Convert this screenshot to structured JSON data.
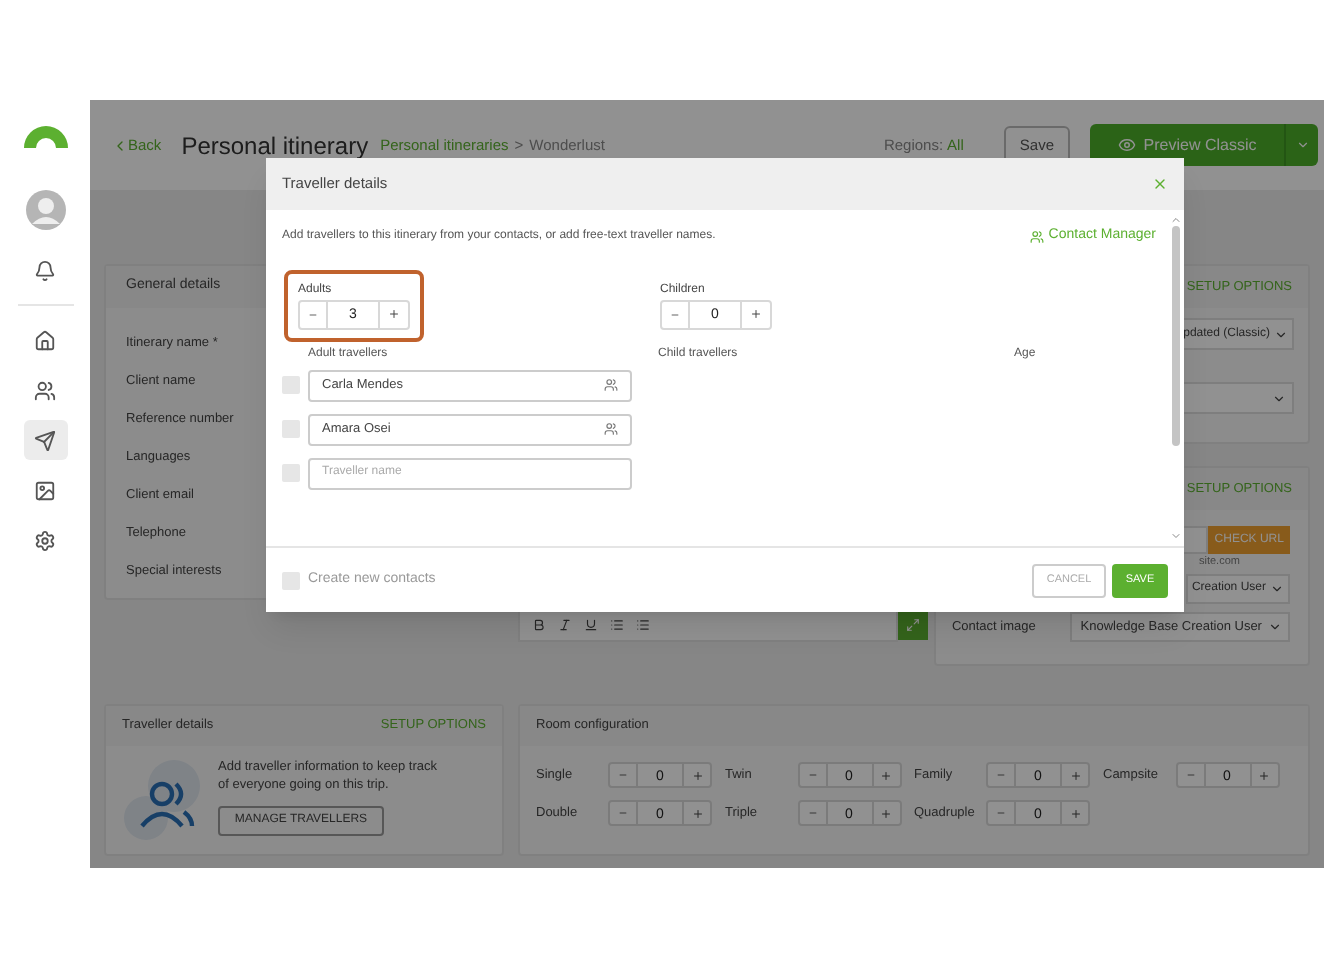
{
  "sidebar": {
    "items": [
      {
        "kind": "home",
        "selected": false
      },
      {
        "kind": "contacts",
        "selected": false
      },
      {
        "kind": "send",
        "selected": true
      },
      {
        "kind": "image",
        "selected": false
      },
      {
        "kind": "settings",
        "selected": false
      }
    ]
  },
  "header": {
    "back": "Back",
    "title": "Personal itinerary",
    "breadcrumb": [
      "Personal itineraries",
      "Wonderlust"
    ],
    "separator": ">",
    "regions_label": "Regions:",
    "regions_value": "All",
    "save": "Save",
    "preview": "Preview Classic"
  },
  "general_details": {
    "title": "General details",
    "fields": [
      "Itinerary name *",
      "Client name",
      "Reference number",
      "Languages",
      "Client email",
      "Telephone",
      "Special interests"
    ]
  },
  "settings_panel": {
    "setup": "SETUP OPTIONS",
    "select": "pdated (Classic)"
  },
  "contact_panel": {
    "setup": "SETUP OPTIONS",
    "check_url": "CHECK URL",
    "hint": "site.com",
    "creator_select": "Creation User",
    "contact_image_label": "Contact image",
    "contact_image_value": "Knowledge Base Creation User"
  },
  "traveller_details": {
    "title": "Traveller details",
    "setup": "SETUP OPTIONS",
    "text": "Add traveller information to keep track of everyone going on this trip.",
    "button": "MANAGE TRAVELLERS"
  },
  "room_configuration": {
    "title": "Room configuration",
    "rooms": [
      {
        "label": "Single",
        "value": "0"
      },
      {
        "label": "Twin",
        "value": "0"
      },
      {
        "label": "Family",
        "value": "0"
      },
      {
        "label": "Campsite",
        "value": "0"
      },
      {
        "label": "Double",
        "value": "0"
      },
      {
        "label": "Triple",
        "value": "0"
      },
      {
        "label": "Quadruple",
        "value": "0"
      }
    ]
  },
  "dialog": {
    "title": "Traveller details",
    "intro": "Add travellers to this itinerary from your contacts, or add free-text traveller names.",
    "contact_manager": "Contact Manager",
    "adults": {
      "label": "Adults",
      "value": "3",
      "highlighted": true
    },
    "children": {
      "label": "Children",
      "value": "0",
      "highlighted": false
    },
    "adult_travellers_label": "Adult travellers",
    "child_travellers_label": "Child travellers",
    "age_label": "Age",
    "adult_travellers": [
      {
        "kind": "contact",
        "value": "Carla Mendes",
        "checked": false
      },
      {
        "kind": "contact",
        "value": "Amara Osei",
        "checked": false
      },
      {
        "kind": "free_text",
        "placeholder": "Traveller name",
        "checked": false
      }
    ],
    "create_contacts": {
      "label": "Create new contacts",
      "checked": false
    },
    "cancel": "CANCEL",
    "save": "SAVE"
  }
}
